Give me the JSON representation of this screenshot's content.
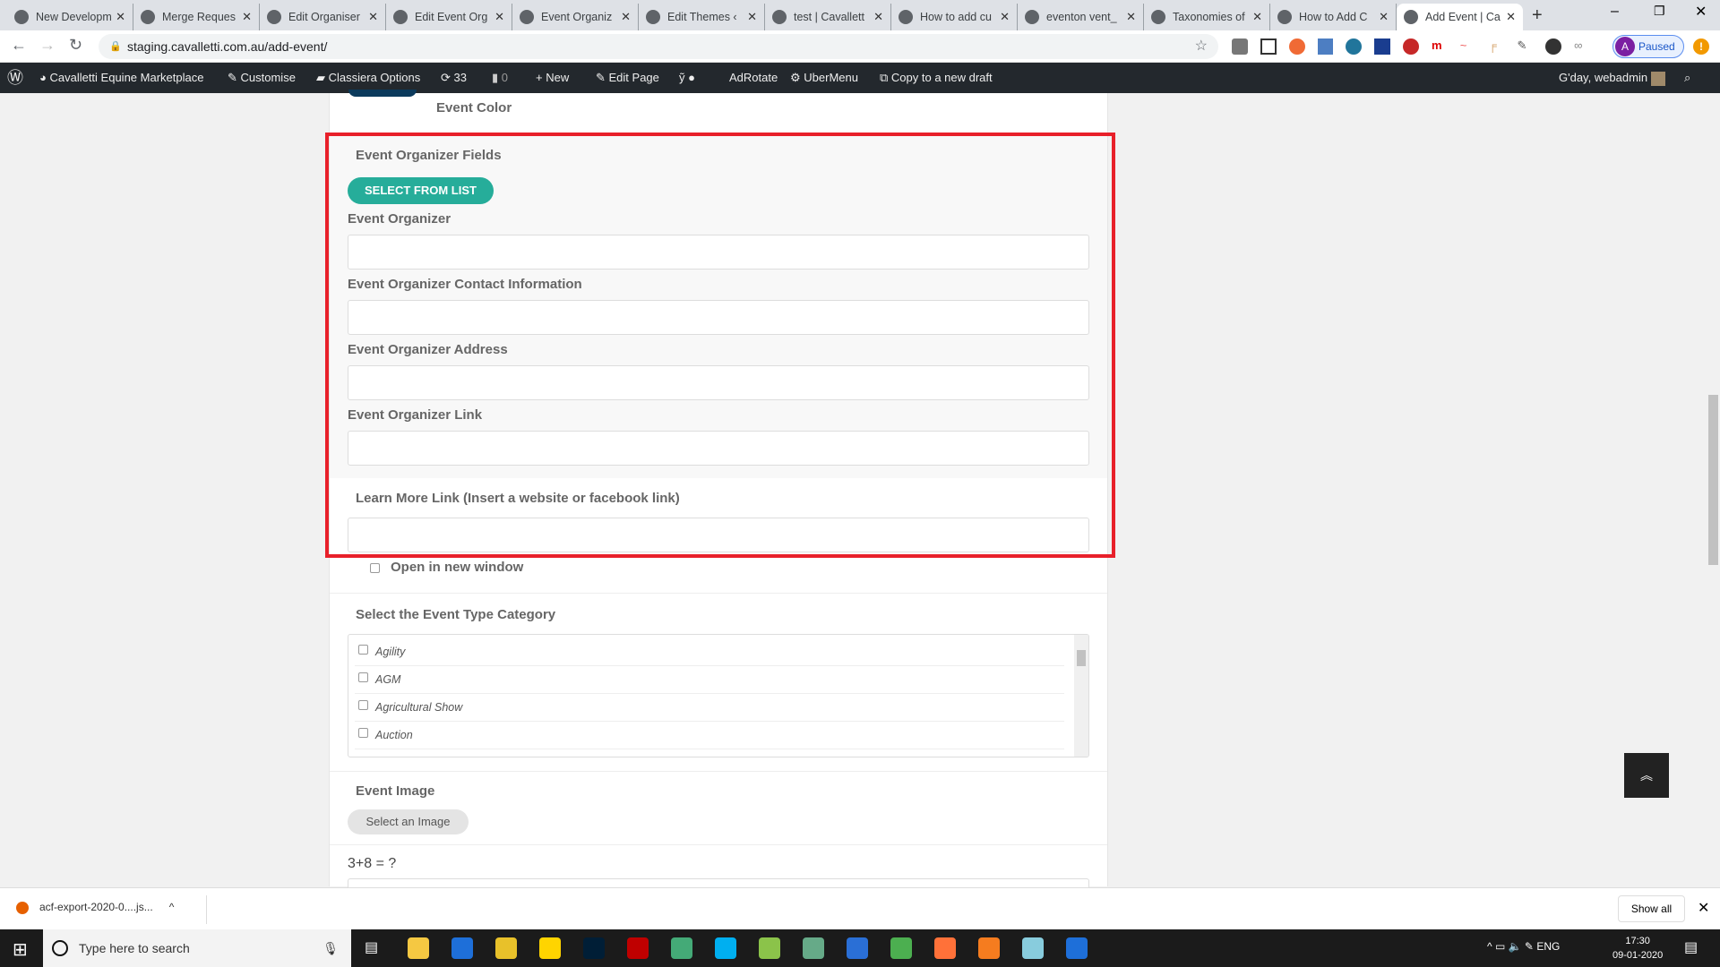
{
  "browser": {
    "tabs": [
      {
        "title": "New Developm",
        "icon": "notebook-icon"
      },
      {
        "title": "Merge Reques",
        "icon": "gitlab-icon"
      },
      {
        "title": "Edit Organiser",
        "icon": "globe-icon"
      },
      {
        "title": "Edit Event Org",
        "icon": "globe-icon"
      },
      {
        "title": "Event Organiz",
        "icon": "globe-icon"
      },
      {
        "title": "Edit Themes ‹",
        "icon": "globe-icon"
      },
      {
        "title": "test | Cavallett",
        "icon": "x-logo-icon"
      },
      {
        "title": "How to add cu",
        "icon": "globe-icon"
      },
      {
        "title": "eventon vent_",
        "icon": "google-icon"
      },
      {
        "title": "Taxonomies of",
        "icon": "12-icon"
      },
      {
        "title": "How to Add C",
        "icon": "orange-icon"
      },
      {
        "title": "Add Event | Ca",
        "icon": "globe-icon"
      }
    ],
    "url": "staging.cavalletti.com.au/add-event/",
    "profile_initial": "A",
    "profile_status": "Paused"
  },
  "adminbar": {
    "site": "Cavalletti Equine Marketplace",
    "customise": "Customise",
    "classiera": "Classiera Options",
    "updates": "33",
    "comments": "0",
    "new": "New",
    "edit_page": "Edit Page",
    "adrotate": "AdRotate",
    "ubermenu": "UberMenu",
    "copy_draft": "Copy to a new draft",
    "greeting": "G'day, webadmin"
  },
  "form": {
    "event_color": "Event Color",
    "organizer_section": "Event Organizer Fields",
    "select_from_list": "SELECT FROM LIST",
    "fields": [
      {
        "label": "Event Organizer",
        "value": ""
      },
      {
        "label": "Event Organizer Contact Information",
        "value": ""
      },
      {
        "label": "Event Organizer Address",
        "value": ""
      },
      {
        "label": "Event Organizer Link",
        "value": ""
      }
    ],
    "learn_more_label": "Learn More Link (Insert a website or facebook link)",
    "learn_more_value": "",
    "open_new_window": "Open in new window",
    "category_label": "Select the Event Type Category",
    "categories": [
      "Agility",
      "AGM",
      "Agricultural Show",
      "Auction"
    ],
    "image_label": "Event Image",
    "select_image": "Select an Image",
    "captcha": "3+8 = ?"
  },
  "downloads": {
    "file": "acf-export-2020-0....js...",
    "show_all": "Show all"
  },
  "taskbar": {
    "search_placeholder": "Type here to search",
    "lang": "ENG",
    "time": "17:30",
    "date": "09-01-2020"
  },
  "colors": {
    "highlight": "#e8202a",
    "teal": "#26ad9a"
  }
}
